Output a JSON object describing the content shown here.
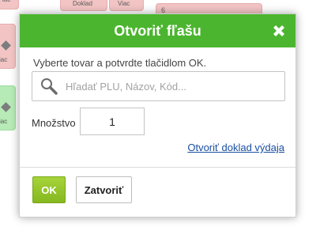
{
  "background": {
    "top_left_fragment": "iac",
    "button_doklad": "Doklad",
    "button_viac": "Viac",
    "card_number": "6",
    "side_label_1": "iac",
    "side_label_2": "iac"
  },
  "dialog": {
    "title": "Otvoriť fľašu",
    "close_icon": "close-icon",
    "instruction": "Vyberte tovar a potvrdte tlačidlom OK.",
    "search": {
      "placeholder": "Hľadať PLU, Názov, Kód...",
      "value": "",
      "icon": "search-icon"
    },
    "quantity": {
      "label": "Množstvo",
      "value": "1"
    },
    "link_text": "Otvoriť doklad výdaja",
    "ok_label": "OK",
    "close_label": "Zatvoriť"
  },
  "colors": {
    "header_green": "#4cb52f",
    "ok_green": "#94c42a",
    "link_blue": "#1a4fa0",
    "tile_pink": "#f2c4c4",
    "tile_green": "#b6eab6"
  }
}
